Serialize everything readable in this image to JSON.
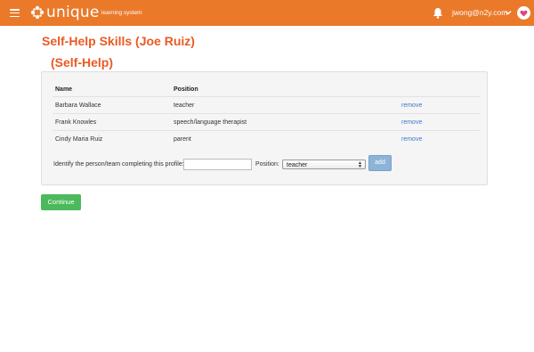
{
  "header": {
    "brand_name": "unique",
    "brand_subtitle": "learning system",
    "user_email": "jwong@n2y.com",
    "icons": [
      "menu-icon",
      "logo-icon",
      "bell-icon",
      "chevron-down-icon",
      "heart-icon"
    ],
    "colors": {
      "bar": "#ea7a2a",
      "heart": "#e0457b"
    }
  },
  "page": {
    "title": "Self-Help Skills (Joe Ruiz)",
    "subtitle": "(Self-Help)",
    "title_color": "#ea5a24"
  },
  "table": {
    "headers": {
      "name": "Name",
      "position": "Position"
    },
    "rows": [
      {
        "name": "Barbara Wallace",
        "position": "teacher",
        "action": "remove"
      },
      {
        "name": "Frank Knowles",
        "position": "speech/language therapist",
        "action": "remove"
      },
      {
        "name": "Cindy Maria Ruiz",
        "position": "parent",
        "action": "remove"
      }
    ]
  },
  "form": {
    "identify_label": "Identify the person/team completing this profile:",
    "identify_value": "",
    "position_label": "Position:",
    "position_selected": "teacher",
    "add_label": "add"
  },
  "actions": {
    "continue_label": "Continue",
    "continue_color": "#4cb95c"
  }
}
